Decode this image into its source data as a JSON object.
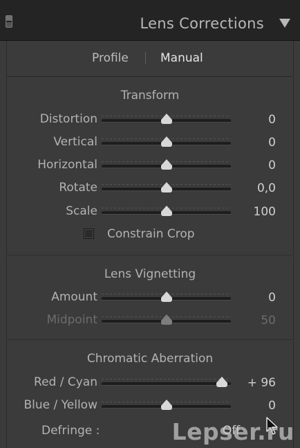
{
  "panel": {
    "title": "Lens Corrections",
    "toggle_icon": "panel-switch-icon",
    "collapse_icon": "triangle-down-icon"
  },
  "tabs": [
    {
      "label": "Profile",
      "selected": false
    },
    {
      "label": "Manual",
      "selected": true
    }
  ],
  "transform": {
    "title": "Transform",
    "sliders": [
      {
        "label": "Distortion",
        "value": "0",
        "position": 0.5
      },
      {
        "label": "Vertical",
        "value": "0",
        "position": 0.5
      },
      {
        "label": "Horizontal",
        "value": "0",
        "position": 0.5
      },
      {
        "label": "Rotate",
        "value": "0,0",
        "position": 0.5
      },
      {
        "label": "Scale",
        "value": "100",
        "position": 0.5
      }
    ],
    "constrain_crop": {
      "label": "Constrain Crop",
      "checked": false
    }
  },
  "vignetting": {
    "title": "Lens Vignetting",
    "sliders": [
      {
        "label": "Amount",
        "value": "0",
        "position": 0.5,
        "disabled": false
      },
      {
        "label": "Midpoint",
        "value": "50",
        "position": 0.5,
        "disabled": true
      }
    ]
  },
  "chromatic": {
    "title": "Chromatic Aberration",
    "sliders": [
      {
        "label": "Red / Cyan",
        "value": "+ 96",
        "position": 0.93
      },
      {
        "label": "Blue / Yellow",
        "value": "0",
        "position": 0.5
      }
    ],
    "defringe_label": "Defringe :",
    "defringe_value": "Off"
  },
  "watermark": "Lepser.ru",
  "colors": {
    "header_bg": "#242424",
    "panel_bg": "#3b3b3b",
    "text": "#b3b3b3",
    "disabled_text": "#6c6c6c"
  }
}
